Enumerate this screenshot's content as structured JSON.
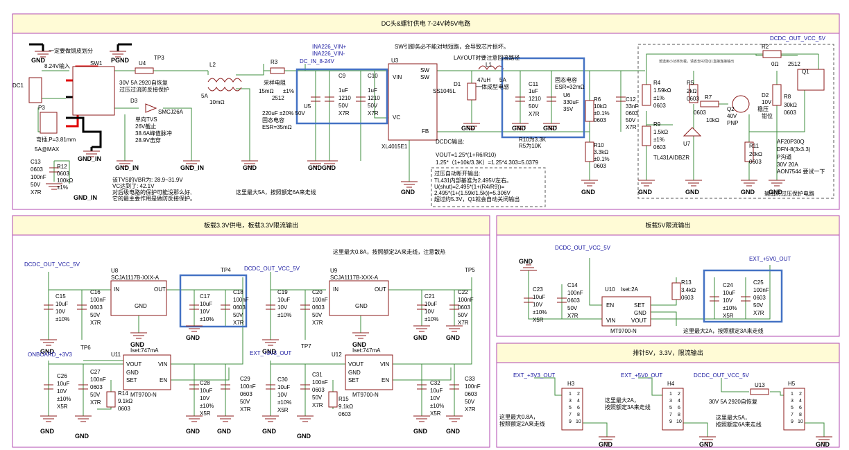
{
  "section_titles": {
    "top": "DC头&螺钉供电 7-24V转5V电路",
    "left": "板载3.3V供电，板载3.3V限流输出",
    "mid": "板载5V限流输出",
    "bottom": "排针5V，3.3V，限流输出"
  },
  "labels": {
    "gnd": "GND",
    "pgnd": "PGND",
    "gnd_in": "GND_IN",
    "gndgnd": "GNDGND",
    "dcdc_out": "DCDC_OUT_VCC_5V",
    "onboard_3v3": "ONBOARD_+3V3",
    "ext_3v3": "EXT_+3V3_OUT",
    "ext_5v0": "EXT_+5V0_OUT",
    "dc_in": "DC_IN_8-24V",
    "ina_p": "INA226_VIN+",
    "ina_n": "INA226_VIN-"
  },
  "notes": {
    "n1": "一定要做镜皮划分",
    "n2": "8.24V输入",
    "n3": "30V 5A 2920自恢复",
    "n4": "过压过流防反接保护",
    "n5": "单向TVS",
    "n6": "26V截止",
    "n7": "38.6A峰值脉冲",
    "n8": "28.9V击穿",
    "n9": "SW引脚务必不能对地短路，会导致芯片损坏。",
    "n10": "LAYOUT时要注意回流路径",
    "n11": "固态电容",
    "n12": "ESR=32mΩ",
    "n13": "DCDC输出:",
    "n14": "VOUT=1.25*(1+R6/R10)",
    "n15": "1.25*（1+10k/3.3K）=1.25*4.303=5.0379",
    "n16": "R10为3.3K",
    "n17": "R5为10K",
    "n18": "过压自动断开输出:",
    "n19": "TL431内部基准为2.495V左右。",
    "n20": "U(shut)=2.495*(1+(R4/R9))=",
    "n21": "2.495*(1+(1.59k/1.5k))=5.306V",
    "n22": "超过约5.3V，Q1就会自动关闭输出",
    "n23": "这里最大5A，按照额定6A来走线",
    "n24": "该TVS的VBR为: 28.9~31.9V",
    "n25": "VC达到了: 42.1V",
    "n26": "对后级电路的保护可能没那么好,",
    "n27": "它的最主要作用是做防反接保护。",
    "n28": "这里最大0.8A，按照额定2A来走线，注意散热",
    "n29": "这里最大2A，按照额定3A来走线",
    "n30": "输出防过压保护电路",
    "n31": "稳压",
    "n32": "钳位",
    "n33": "这里最大0.8A，",
    "n34": "按照额定2A来走线",
    "n35": "这里最大2A，",
    "n36": "按照额定3A来走线",
    "n37": "这里最大5A，",
    "n38": "按照额定6A来走线",
    "n39": "采样电阻",
    "n40": "固态电容",
    "n41": "ESR=35mΩ",
    "n42": "一体成型电感",
    "n43": "弯插,P=3.81mm",
    "n44": "5A@MAX",
    "n45": "30V 5A 2920自恢复",
    "n46": "AON7544 要试一下"
  },
  "parts": {
    "dc1": "DC1",
    "p3": "P3",
    "sw1": "SW1",
    "u4": "U4",
    "tp3": "TP3",
    "d3": "D3",
    "smcj": "SMCJ26A",
    "l2": "L2",
    "l2v": "10mΩ",
    "l2a": "5A",
    "r3": "R3",
    "r3v": "15mΩ",
    "r3t": "±1%",
    "r3p": "2512",
    "u5": "U5",
    "c9": "C9",
    "c10": "C10",
    "cap_1uf": "1uF",
    "p1210": "1210",
    "v50": "50V",
    "x7r": "X7R",
    "u3": "U3",
    "xl": "XL4015E1",
    "vin": "VIN",
    "vc": "VC",
    "fb": "FB",
    "sw": "SW",
    "gnd_pin": "GND",
    "d1": "D1",
    "ss": "SS1045L",
    "l1": "L1",
    "l1v": "47uH",
    "l1a": "5A",
    "c11": "C11",
    "u6": "U6",
    "u6v": "330uF",
    "u6vv": "35V",
    "r6": "R6",
    "r6v": "10kΩ",
    "r6t": "±0.1%",
    "p0603": "0603",
    "r10": "R10",
    "r10v": "3.3kΩ",
    "c12": "C12",
    "c12v": "33nF",
    "r4": "R4",
    "r4v": "1.59kΩ",
    "t1": "±1%",
    "r9": "R9",
    "r9v": "1.5kΩ",
    "u7": "U7",
    "tl431": "TL431AIDBZR",
    "r5": "R5",
    "r5v": "2kΩ",
    "r7": "R7",
    "r7v": "10kΩ",
    "q2": "Q2",
    "q2v": "40V",
    "pnp": "PNP",
    "d2": "D2",
    "d2v": "10V",
    "r8": "R8",
    "r8v": "30kΩ",
    "r11": "R11",
    "r11v": "20kΩ",
    "r2": "R2",
    "r2v": "0Ω",
    "r2p": "2512",
    "q1": "Q1",
    "q1a": "AF20P30Q",
    "q1b": "DFN-8(3x3.3)",
    "q1c": "P沟道",
    "q1d": "30V        20A",
    "c13": "C13",
    "c13v": "100nF",
    "r12": "R12",
    "r12v": "100kΩ",
    "u8": "U8",
    "u9": "U9",
    "scja": "SCJA1117B-XXX-A",
    "in": "IN",
    "out": "OUT",
    "c15": "C15",
    "c16": "C16",
    "c17": "C17",
    "c18": "C18",
    "c19": "C19",
    "c20": "C20",
    "c21": "C21",
    "c22": "C22",
    "uf10": "10uF",
    "v10": "10V",
    "t10": "±10%",
    "nf100": "100nF",
    "tp4": "TP4",
    "tp5": "TP5",
    "tp6": "TP6",
    "tp7": "TP7",
    "u11": "U11",
    "u12": "U12",
    "u10": "U10",
    "iset747": "Iset:747mA",
    "iset2": "Iset:2A",
    "mt": "MT9700-N",
    "vout": "VOUT",
    "set": "SET",
    "en": "EN",
    "c26": "C26",
    "c27": "C27",
    "c28": "C28",
    "c29": "C29",
    "c30": "C30",
    "c31": "C31",
    "c32": "C32",
    "c33": "C33",
    "r14": "R14",
    "r15": "R15",
    "k91": "9.1kΩ",
    "x5r": "X5R",
    "c23": "C23",
    "c14": "C14",
    "c24": "C24",
    "c25": "C25",
    "r13": "R13",
    "r13v": "3.4kΩ",
    "h3": "H3",
    "h4": "H4",
    "h5": "H5",
    "u13": "U13"
  }
}
